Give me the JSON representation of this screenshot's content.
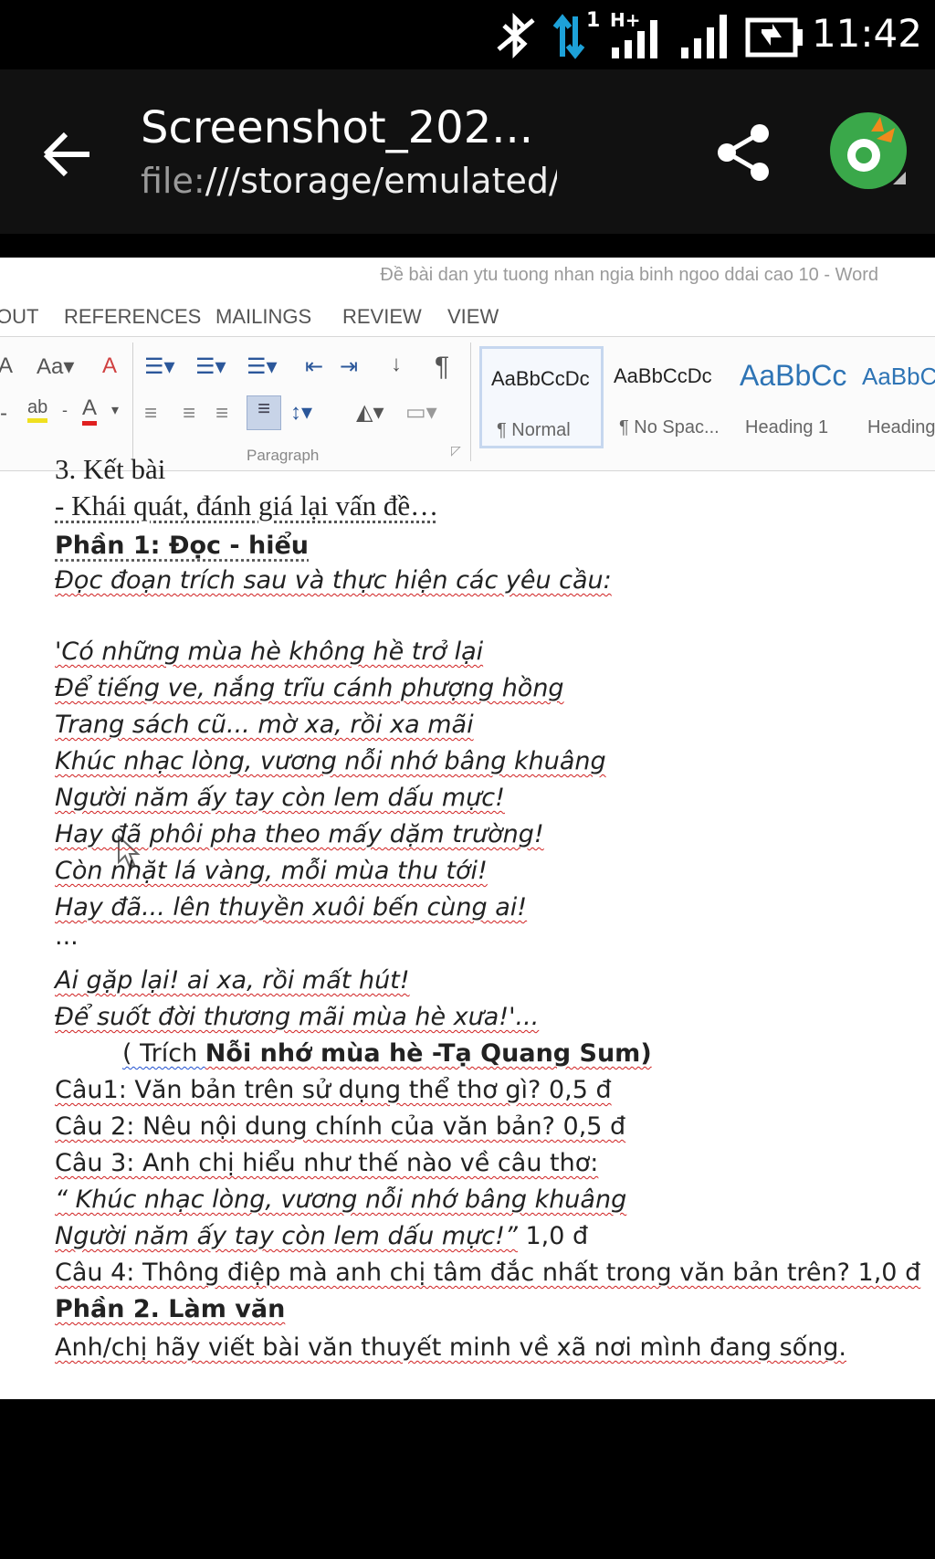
{
  "status_bar": {
    "time": "11:42",
    "network_type": "H+",
    "sim_slot": "1",
    "icons": [
      "bluetooth-off-icon",
      "data-transfer-icon",
      "signal-h-plus-icon",
      "signal-icon",
      "battery-charging-icon"
    ]
  },
  "app_bar": {
    "title": "Screenshot_202...",
    "url_scheme": "file:",
    "url_rest": "///storage/emulated/(",
    "icons": [
      "back-arrow-icon",
      "share-icon",
      "coc-coc-browser-icon"
    ]
  },
  "word": {
    "doc_title": "Đề bài dan ytu tuong nhan ngia binh ngoo ddai cao 10 - Word",
    "tabs": [
      "OUT",
      "REFERENCES",
      "MAILINGS",
      "REVIEW",
      "VIEW"
    ],
    "paragraph_group_label": "Paragraph",
    "font_size_label": "Aa",
    "styles": [
      {
        "sample": "AaBbCcDc",
        "name": "¶ Normal"
      },
      {
        "sample": "AaBbCcDc",
        "name": "¶ No Spac..."
      },
      {
        "sample": "AaBbCc",
        "name": "Heading 1"
      },
      {
        "sample": "AaBbC",
        "name": "Heading"
      }
    ],
    "accent_color": "#2b579a"
  },
  "document": {
    "line_cut": "3. Kết bài",
    "conclusion": "- Khái quát, đánh giá lại vấn đề…",
    "part1_heading": "Phần 1: Đọc - hiểu",
    "instruction": "Đọc đoạn trích sau và thực hiện các yêu cầu:",
    "poem": [
      "'Có những mùa hè không hề trở lại",
      "Để tiếng ve, nắng trĩu cánh phượng hồng",
      "Trang sách cũ... mờ xa, rồi xa mãi",
      "Khúc nhạc lòng, vương nỗi nhớ bâng khuâng",
      "Người năm ấy tay còn lem dấu mực!",
      "Hay đã phôi pha theo mấy dặm trường!",
      "Còn nhặt lá vàng, mỗi mùa thu tới!",
      "Hay đã... lên thuyền xuôi bến cùng ai!"
    ],
    "ellipsis": "...",
    "poem_end": [
      "Ai gặp lại! ai xa, rồi mất hút!",
      "Để suốt đời thương mãi mùa hè xưa!'..."
    ],
    "source_prefix": "( Trích ",
    "source_bold": "Nỗi nhớ mùa hè -Tạ Quang Sum)",
    "questions": [
      "Câu1: Văn bản trên sử dụng thể thơ gì? 0,5 đ",
      "Câu 2: Nêu nội dung chính của văn bản? 0,5 đ",
      "Câu 3: Anh chị hiểu như thế nào về câu thơ:"
    ],
    "quote_line1": "“ Khúc nhạc lòng, vương nỗi nhớ bâng khuâng",
    "quote_line2": "Người năm ấy tay còn lem dấu mực!”",
    "quote_points": " 1,0 đ",
    "question4": "Câu 4: Thông điệp mà anh chị tâm đắc nhất trong văn bản trên? 1,0 đ",
    "part2_heading": "Phần 2. Làm văn",
    "part2_task": "Anh/chị hãy viết bài văn thuyết minh về xã nơi mình đang sống."
  }
}
